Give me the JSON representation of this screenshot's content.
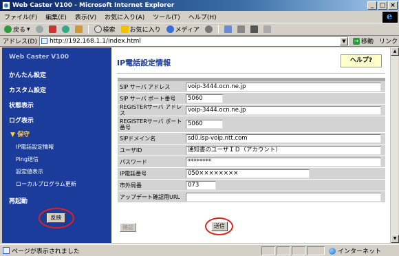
{
  "window": {
    "title": "Web Caster V100 - Microsoft Internet Explorer",
    "min": "_",
    "max": "□",
    "close": "×"
  },
  "menu": [
    "ファイル(F)",
    "編集(E)",
    "表示(V)",
    "お気に入り(A)",
    "ツール(T)",
    "ヘルプ(H)"
  ],
  "toolbar": {
    "back": "戻る",
    "search": "検索",
    "favorites": "お気に入り",
    "media": "メディア"
  },
  "address": {
    "label": "アドレス(D)",
    "url": "http://192.168.1.1/index.html",
    "go": "移動",
    "links": "リンク"
  },
  "nav": {
    "brand": "Web Caster V100",
    "items": [
      "かんたん設定",
      "カスタム設定",
      "状態表示",
      "ログ表示"
    ],
    "section": "▼ 保守",
    "subitems": [
      "IP電話設定情報",
      "Ping送信",
      "設定値表示",
      "ローカルプログラム更新"
    ],
    "restart": "再起動",
    "apply": "反映"
  },
  "content": {
    "title": "IP電話設定情報",
    "help": "ヘルプ?",
    "fields": [
      {
        "label": "SIP サーバ アドレス",
        "value": "voip-3444.ocn.ne.jp"
      },
      {
        "label": "SIP サーバ ポート番号",
        "value": "5060"
      },
      {
        "label": "REGISTERサーバ アドレス",
        "value": "voip-3444.ocn.ne.jp"
      },
      {
        "label": "REGISTERサーバ ポート番号",
        "value": "5060"
      },
      {
        "label": "SIPドメイン名",
        "value": "sd0.isp-voip.ntt.com"
      },
      {
        "label": "ユーザID",
        "value": "通知書のユーザＩＤ（アカウント）"
      },
      {
        "label": "パスワード",
        "value": "********"
      },
      {
        "label": "IP電話番号",
        "value": "050××××××××"
      },
      {
        "label": "市外局番",
        "value": "073"
      },
      {
        "label": "アップデート確認用URL",
        "value": ""
      }
    ],
    "confirm": "確認",
    "send": "送信"
  },
  "status": {
    "text": "ページが表示されました",
    "zone": "インターネット"
  }
}
